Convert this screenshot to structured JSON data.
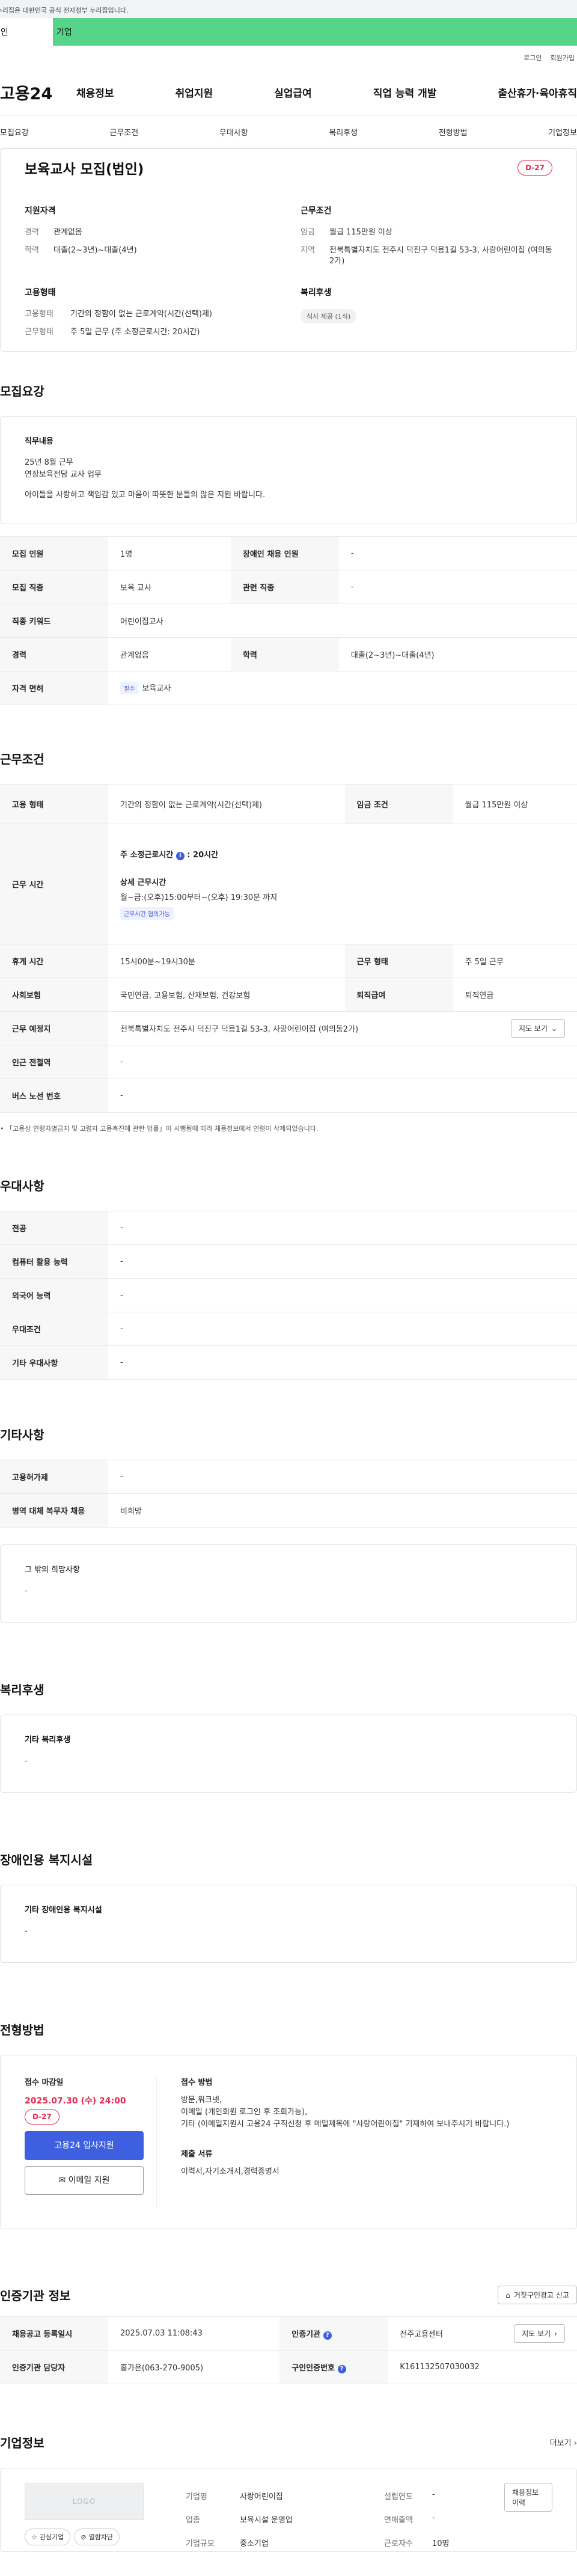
{
  "gov_notice": "이 누리집은 대한민국 공식 전자정부 누리집입니다.",
  "user_tabs": {
    "person": "개인",
    "company": "기업"
  },
  "util": {
    "login": "로그인",
    "join": "회원가입"
  },
  "logo": "고용24",
  "gnb": [
    "채용정보",
    "취업지원",
    "실업급여",
    "직업 능력 개발",
    "출산휴가·육아휴직"
  ],
  "subnav": [
    "모집요강",
    "근무조건",
    "우대사항",
    "복리후생",
    "전형방법",
    "기업정보"
  ],
  "header": {
    "title": "보육교사 모집(법인)",
    "dday": "D-27",
    "qual_title": "지원자격",
    "qual": [
      {
        "k": "경력",
        "v": "관계없음"
      },
      {
        "k": "학력",
        "v": "대졸(2~3년)~대졸(4년)"
      }
    ],
    "cond_title": "근무조건",
    "cond": [
      {
        "k": "임금",
        "v": "월급 115만원 이상"
      },
      {
        "k": "지역",
        "v": "전북특별자치도 전주시 덕진구 덕용1길 53-3, 사랑어린이집 (여의동2가)"
      }
    ],
    "emp_title": "고용형태",
    "emp": [
      {
        "k": "고용형태",
        "v": "기간의 정함이 없는 근로계약(시간(선택)제)"
      },
      {
        "k": "근무형태",
        "v": "주 5일 근무 (주 소정근로시간: 20시간)"
      }
    ],
    "welfare_title": "복리후생",
    "welfare_chip": "식사 제공 (1식)"
  },
  "recruit": {
    "section_title": "모집요강",
    "duty_label": "직무내용",
    "duty_lines": [
      "25년 8월 근무",
      "연장보육전담 교사 업무"
    ],
    "duty_extra": "아이들을 사랑하고 책임감 있고 마음이 따뜻한 분들의 많은 지원 바랍니다.",
    "rows": {
      "count_k": "모집 인원",
      "count_v": "1명",
      "disabled_k": "장애인 채용 인원",
      "disabled_v": "-",
      "job_k": "모집 직종",
      "job_v": "보육 교사",
      "related_k": "관련 직종",
      "related_v": "-",
      "keyword_k": "직종 키워드",
      "keyword_v": "어린이집교사",
      "career_k": "경력",
      "career_v": "관계없음",
      "edu_k": "학력",
      "edu_v": "대졸(2~3년)~대졸(4년)",
      "license_k": "자격 면허",
      "license_badge": "필수",
      "license_v": "보육교사"
    }
  },
  "work": {
    "section_title": "근무조건",
    "emp_k": "고용 형태",
    "emp_v": "기간의 정함이 없는 근로계약(시간(선택)제)",
    "wage_k": "임금 조건",
    "wage_v": "월급 115만원 이상",
    "hours_k": "근무 시간",
    "hours_week": "주 소정근로시간",
    "hours_week_v": "20시간",
    "hours_detail_label": "상세 근무시간",
    "hours_detail": "월~금:(오후)15:00부터~(오후) 19:30분 까지",
    "hours_tag": "근무시간 협의가능",
    "rest_k": "휴게 시간",
    "rest_v": "15시00분~19시30분",
    "type_k": "근무 형태",
    "type_v": "주 5일 근무",
    "insurance_k": "사회보험",
    "insurance_v": "국민연금, 고용보험, 산재보험, 건강보험",
    "retire_k": "퇴직급여",
    "retire_v": "퇴직연금",
    "place_k": "근무 예정지",
    "place_v": "전북특별자치도 전주시 덕진구 덕용1길 53-3, 사랑어린이집 (여의동2가)",
    "map_btn": "지도 보기",
    "subway_k": "인근 전철역",
    "subway_v": "-",
    "bus_k": "버스 노선 번호",
    "bus_v": "-",
    "note": "「고용상 연령차별금지 및 고령자 고용촉진에 관한 법률」이 시행됨에 따라 채용정보에서 연령이 삭제되었습니다."
  },
  "pref": {
    "section_title": "우대사항",
    "rows": [
      {
        "k": "전공",
        "v": "-"
      },
      {
        "k": "컴퓨터 활용 능력",
        "v": "-"
      },
      {
        "k": "외국어 능력",
        "v": "-"
      },
      {
        "k": "우대조건",
        "v": "-"
      },
      {
        "k": "기타 우대사항",
        "v": "-"
      }
    ]
  },
  "etc": {
    "section_title": "기타사항",
    "rows": [
      {
        "k": "고용허가제",
        "v": "-"
      },
      {
        "k": "병역 대체 복무자 채용",
        "v": "비희망"
      }
    ],
    "wish_label": "그 밖의 희망사항",
    "wish_v": "-"
  },
  "benefit": {
    "section_title": "복리후생",
    "label": "기타 복리후생",
    "value": "-"
  },
  "disabled_fac": {
    "section_title": "장애인용 복지시설",
    "label": "기타 장애인용 복지시설",
    "value": "-"
  },
  "screening": {
    "section_title": "전형방법",
    "deadline_label": "접수 마감일",
    "deadline": "2025.07.30 (수) 24:00",
    "dday": "D-27",
    "apply_btn": "고용24 입사지원",
    "email_btn": "이메일 지원",
    "method_label": "접수 방법",
    "method_lines": [
      "방문,워크넷,",
      "이메일 (개인회원 로그인 후 조회가능),",
      "기타 (이메일지원시 고용24 구직신청 후 메일제목에 \"사랑어린이집\" 기재하여 보내주시기 바랍니다.)"
    ],
    "docs_label": "제출 서류",
    "docs": "이력서,자기소개서,경력증명서"
  },
  "agency": {
    "section_title": "인증기관 정보",
    "report_btn": "거짓구인광고 신고",
    "reg_k": "채용공고 등록일시",
    "reg_v": "2025.07.03 11:08:43",
    "org_k": "인증기관",
    "org_v": "전주고용센터",
    "map_btn": "지도 보기",
    "mgr_k": "인증기관 담당자",
    "mgr_v": "홍가은(063-270-9005)",
    "num_k": "구인인증번호",
    "num_v": "K161132507030032"
  },
  "company": {
    "section_title": "기업정보",
    "more": "더보기",
    "logo_text": "LOGO",
    "fav_btn": "관심기업",
    "block_btn": "열람차단",
    "history_btn": "채용정보 이력",
    "name_k": "기업명",
    "name_v": "사랑어린이집",
    "founded_k": "설립연도",
    "founded_v": "-",
    "industry_k": "업종",
    "industry_v": "보육시설 운영업",
    "sales_k": "연매출액",
    "sales_v": "-",
    "size_k": "기업규모",
    "size_v": "중소기업",
    "emp_k": "근로자수",
    "emp_v": "10명"
  }
}
